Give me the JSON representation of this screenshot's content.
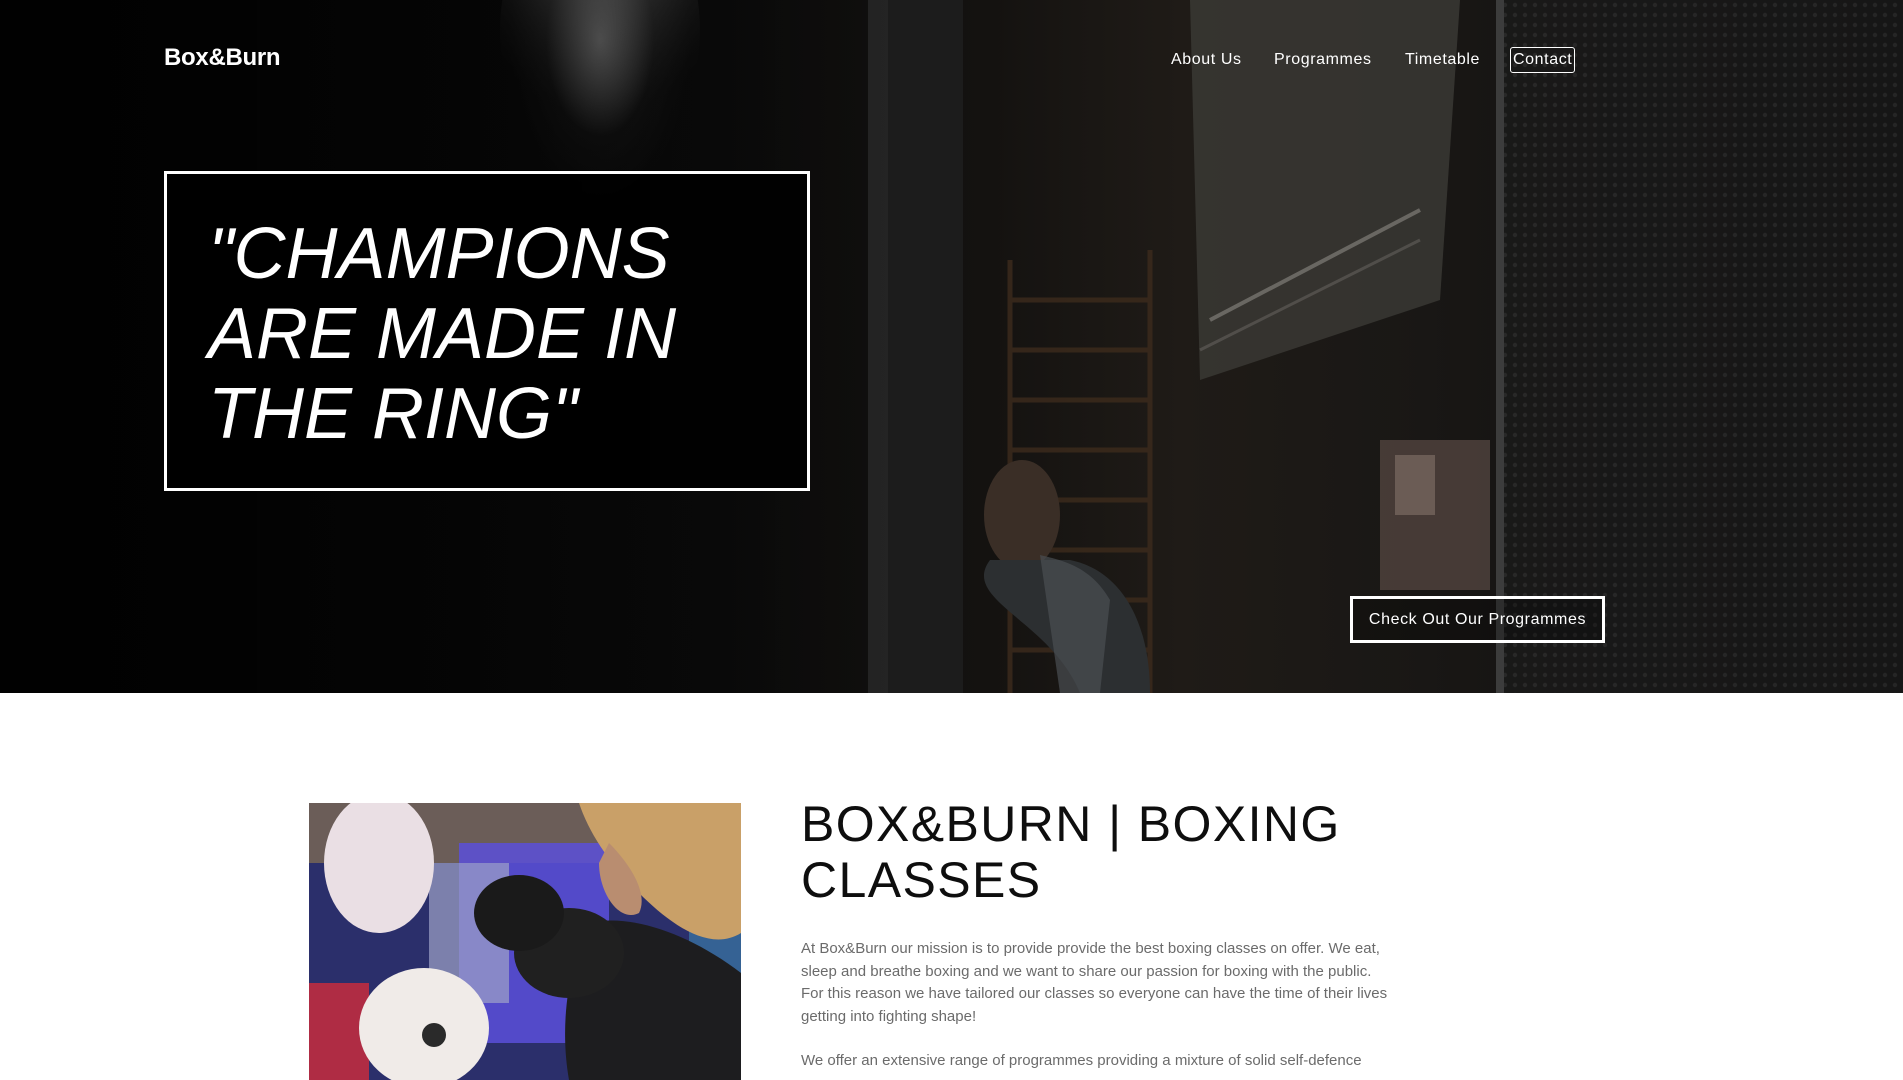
{
  "header": {
    "logo": "Box&Burn",
    "nav": [
      "About Us",
      "Programmes",
      "Timetable",
      "Contact"
    ]
  },
  "hero": {
    "quote": "\"CHAMPIONS ARE MADE IN THE RING\"",
    "cta_label": "Check Out Our Programmes",
    "image": "boxer-in-dark-gym"
  },
  "about": {
    "image": "woman-boxing-pads",
    "heading": "BOX&BURN | BOXING CLASSES",
    "paragraphs": [
      "At Box&Burn our mission is to provide provide the best boxing classes on offer. We eat, sleep and breathe boxing and we want to share our passion for boxing with the public. For this reason we have tailored our classes so everyone can have the time of their lives getting into fighting shape!",
      "We offer an extensive range of programmes providing a mixture of solid self-defence"
    ]
  },
  "colors": {
    "hero_overlay": "#050505",
    "text_white": "#ffffff",
    "heading": "#0e0e0e",
    "body_text": "#6b6b6b",
    "background": "#ffffff"
  }
}
